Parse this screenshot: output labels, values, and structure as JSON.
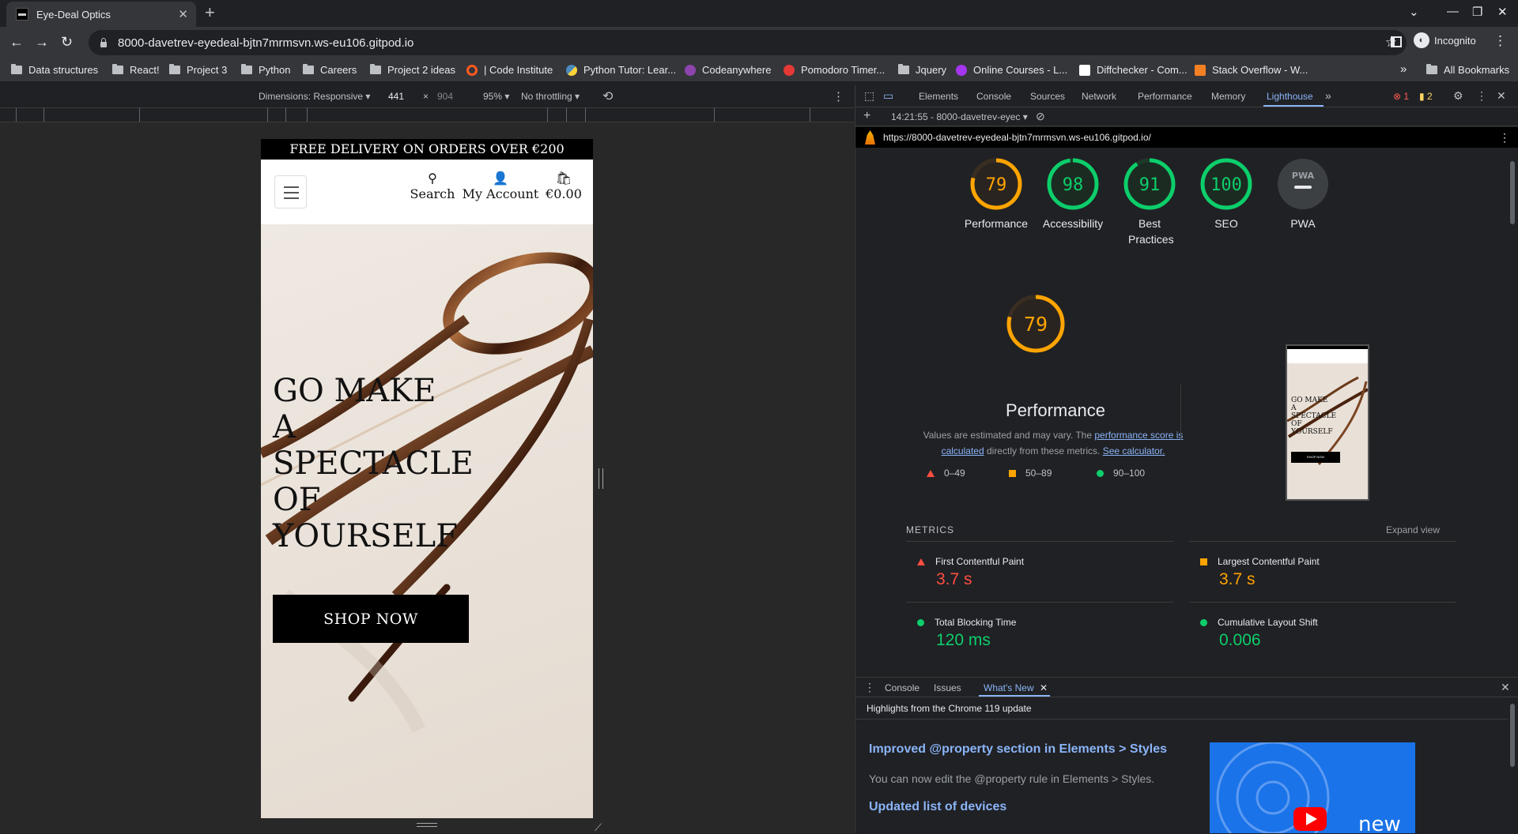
{
  "browser": {
    "tab_title": "Eye-Deal Optics",
    "url": "8000-davetrev-eyedeal-bjtn7mrmsvn.ws-eu106.gitpod.io",
    "profile_label": "Incognito",
    "bookmarks": [
      {
        "label": "Data structures",
        "icon": "folder-icon"
      },
      {
        "label": "React!",
        "icon": "folder-icon"
      },
      {
        "label": "Project 3",
        "icon": "folder-icon"
      },
      {
        "label": "Python",
        "icon": "folder-icon"
      },
      {
        "label": "Careers",
        "icon": "folder-icon"
      },
      {
        "label": "Project 2 ideas",
        "icon": "folder-icon"
      },
      {
        "label": "| Code Institute",
        "icon": "code-institute-icon",
        "color": "#ff5a1f"
      },
      {
        "label": "Python Tutor: Lear...",
        "icon": "python-icon",
        "color": "#4b8bbe"
      },
      {
        "label": "Codeanywhere",
        "icon": "codeanywhere-icon",
        "color": "#8e44ad"
      },
      {
        "label": "Pomodoro Timer...",
        "icon": "pomodoro-icon",
        "color": "#e53935"
      },
      {
        "label": "Jquery",
        "icon": "folder-icon"
      },
      {
        "label": "Online Courses - L...",
        "icon": "udemy-icon",
        "color": "#a435f0"
      },
      {
        "label": "Diffchecker - Com...",
        "icon": "diffchecker-icon",
        "color": "#ffffff"
      },
      {
        "label": "Stack Overflow - W...",
        "icon": "stackoverflow-icon",
        "color": "#f48024"
      }
    ],
    "bookmarks_overflow": "»",
    "all_bookmarks": "All Bookmarks"
  },
  "device_toolbar": {
    "dimensions": "Dimensions: Responsive",
    "width": "441",
    "times": "×",
    "height": "904",
    "zoom": "95%",
    "throttling": "No throttling"
  },
  "site": {
    "promo": "FREE DELIVERY ON ORDERS OVER €200",
    "nav_search": "Search",
    "nav_account": "My Account",
    "nav_bag": "€0.00",
    "hero_title": "GO MAKE A SPECTACLE OF YOURSELF",
    "hero_title_lines": [
      "GO MAKE",
      "A",
      "SPECTACLE",
      "OF",
      "YOURSELF"
    ],
    "cta": "SHOP NOW"
  },
  "devtools": {
    "tabs": [
      "Elements",
      "Console",
      "Sources",
      "Network",
      "Performance",
      "Memory",
      "Lighthouse"
    ],
    "active_tab": "Lighthouse",
    "error_count": "1",
    "warning_count": "2",
    "report_selector": "14:21:55 - 8000-davetrev-eyec",
    "report_url": "https://8000-davetrev-eyedeal-bjtn7mrmsvn.ws-eu106.gitpod.io/",
    "scores": [
      {
        "label": "Performance",
        "value": "79",
        "color": "#ffa400",
        "fill": 0.79
      },
      {
        "label": "Accessibility",
        "value": "98",
        "color": "#0cce6b",
        "fill": 0.98
      },
      {
        "label": "Best Practices",
        "value": "91",
        "color": "#0cce6b",
        "fill": 0.91
      },
      {
        "label": "SEO",
        "value": "100",
        "color": "#0cce6b",
        "fill": 1.0
      },
      {
        "label": "PWA",
        "value": "PWA",
        "color": "#9aa0a6",
        "fill": 0
      }
    ],
    "performance": {
      "score": "79",
      "title": "Performance",
      "desc_before": "Values are estimated and may vary. The ",
      "desc_link1": "performance score is calculated",
      "desc_middle": " directly from these metrics. ",
      "desc_link2": "See calculator.",
      "legend": [
        "0–49",
        "50–89",
        "90–100"
      ]
    },
    "thumbnail": {
      "title": "GO MAKE A SPECTACLE OF YOURSELF",
      "cta": "SHOP NOW"
    },
    "metrics_header": "METRICS",
    "expand_view": "Expand view",
    "metrics": [
      {
        "label": "First Contentful Paint",
        "value": "3.7 s",
        "status": "fail",
        "color": "#ff4e42"
      },
      {
        "label": "Largest Contentful Paint",
        "value": "3.7 s",
        "status": "average",
        "color": "#ffa400"
      },
      {
        "label": "Total Blocking Time",
        "value": "120 ms",
        "status": "pass",
        "color": "#0cce6b"
      },
      {
        "label": "Cumulative Layout Shift",
        "value": "0.006",
        "status": "pass",
        "color": "#0cce6b"
      }
    ],
    "drawer": {
      "tabs": [
        "Console",
        "Issues",
        "What's New"
      ],
      "active_tab": "What's New",
      "highlights": "Highlights from the Chrome 119 update",
      "items": [
        {
          "title": "Improved @property section in Elements > Styles",
          "desc": "You can now edit the @property rule in Elements > Styles."
        },
        {
          "title": "Updated list of devices",
          "desc": ""
        }
      ],
      "video_label": "new"
    }
  }
}
